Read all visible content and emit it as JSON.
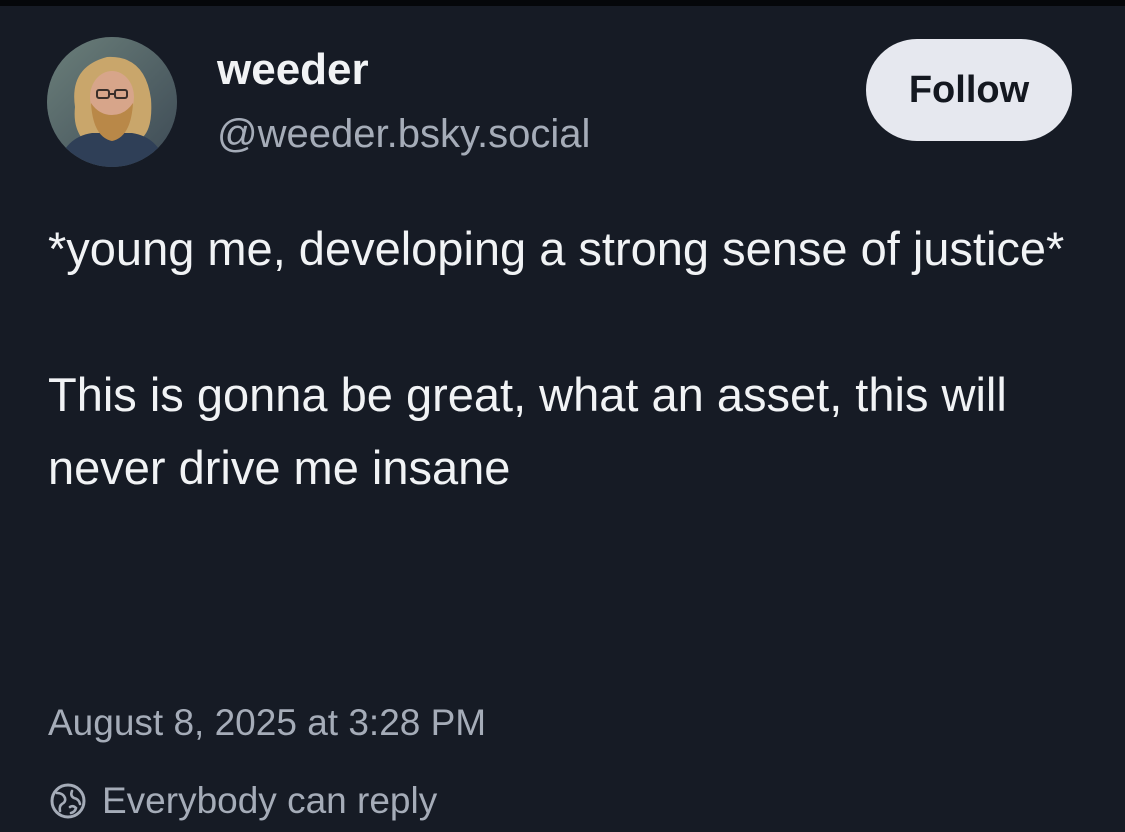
{
  "author": {
    "display_name": "weeder",
    "handle": "@weeder.bsky.social",
    "avatar_icon": "profile-photo"
  },
  "follow_label": "Follow",
  "post": {
    "paragraphs": [
      "*young me, developing a strong sense of justice*",
      "This is gonna be great, what an asset, this will never drive me insane"
    ],
    "timestamp": "August 8, 2025 at 3:28 PM",
    "reply_setting": "Everybody can reply",
    "reply_icon": "globe-earth-icon"
  },
  "colors": {
    "background": "#161b25",
    "text_primary": "#f1f3f5",
    "text_secondary": "#a5acb8",
    "follow_button_bg": "#e6e8ef",
    "follow_button_text": "#141820"
  }
}
